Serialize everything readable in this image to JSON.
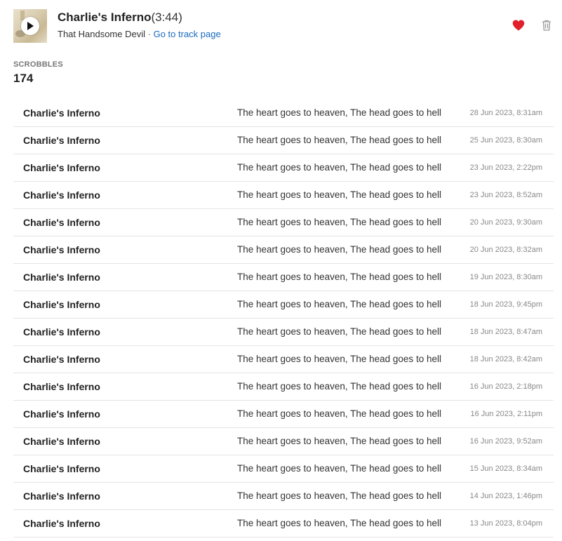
{
  "header": {
    "track_title": "Charlie's Inferno",
    "duration": "(3:44)",
    "artist": "That Handsome Devil",
    "separator": "·",
    "link_text": "Go to track page"
  },
  "icons": {
    "play": "play-icon",
    "love": "heart-icon",
    "delete": "trash-icon"
  },
  "colors": {
    "love": "#e0202a",
    "link": "#1a6bbf",
    "trash": "#999999"
  },
  "stats": {
    "label": "SCROBBLES",
    "value": "174"
  },
  "scrobbles": [
    {
      "track": "Charlie's Inferno",
      "album": "The heart goes to heaven, The head goes to hell",
      "time": "28 Jun 2023, 8:31am"
    },
    {
      "track": "Charlie's Inferno",
      "album": "The heart goes to heaven, The head goes to hell",
      "time": "25 Jun 2023, 8:30am"
    },
    {
      "track": "Charlie's Inferno",
      "album": "The heart goes to heaven, The head goes to hell",
      "time": "23 Jun 2023, 2:22pm"
    },
    {
      "track": "Charlie's Inferno",
      "album": "The heart goes to heaven, The head goes to hell",
      "time": "23 Jun 2023, 8:52am"
    },
    {
      "track": "Charlie's Inferno",
      "album": "The heart goes to heaven, The head goes to hell",
      "time": "20 Jun 2023, 9:30am"
    },
    {
      "track": "Charlie's Inferno",
      "album": "The heart goes to heaven, The head goes to hell",
      "time": "20 Jun 2023, 8:32am"
    },
    {
      "track": "Charlie's Inferno",
      "album": "The heart goes to heaven, The head goes to hell",
      "time": "19 Jun 2023, 8:30am"
    },
    {
      "track": "Charlie's Inferno",
      "album": "The heart goes to heaven, The head goes to hell",
      "time": "18 Jun 2023, 9:45pm"
    },
    {
      "track": "Charlie's Inferno",
      "album": "The heart goes to heaven, The head goes to hell",
      "time": "18 Jun 2023, 8:47am"
    },
    {
      "track": "Charlie's Inferno",
      "album": "The heart goes to heaven, The head goes to hell",
      "time": "18 Jun 2023, 8:42am"
    },
    {
      "track": "Charlie's Inferno",
      "album": "The heart goes to heaven, The head goes to hell",
      "time": "16 Jun 2023, 2:18pm"
    },
    {
      "track": "Charlie's Inferno",
      "album": "The heart goes to heaven, The head goes to hell",
      "time": "16 Jun 2023, 2:11pm"
    },
    {
      "track": "Charlie's Inferno",
      "album": "The heart goes to heaven, The head goes to hell",
      "time": "16 Jun 2023, 9:52am"
    },
    {
      "track": "Charlie's Inferno",
      "album": "The heart goes to heaven, The head goes to hell",
      "time": "15 Jun 2023, 8:34am"
    },
    {
      "track": "Charlie's Inferno",
      "album": "The heart goes to heaven, The head goes to hell",
      "time": "14 Jun 2023, 1:46pm"
    },
    {
      "track": "Charlie's Inferno",
      "album": "The heart goes to heaven, The head goes to hell",
      "time": "13 Jun 2023, 8:04pm"
    }
  ]
}
